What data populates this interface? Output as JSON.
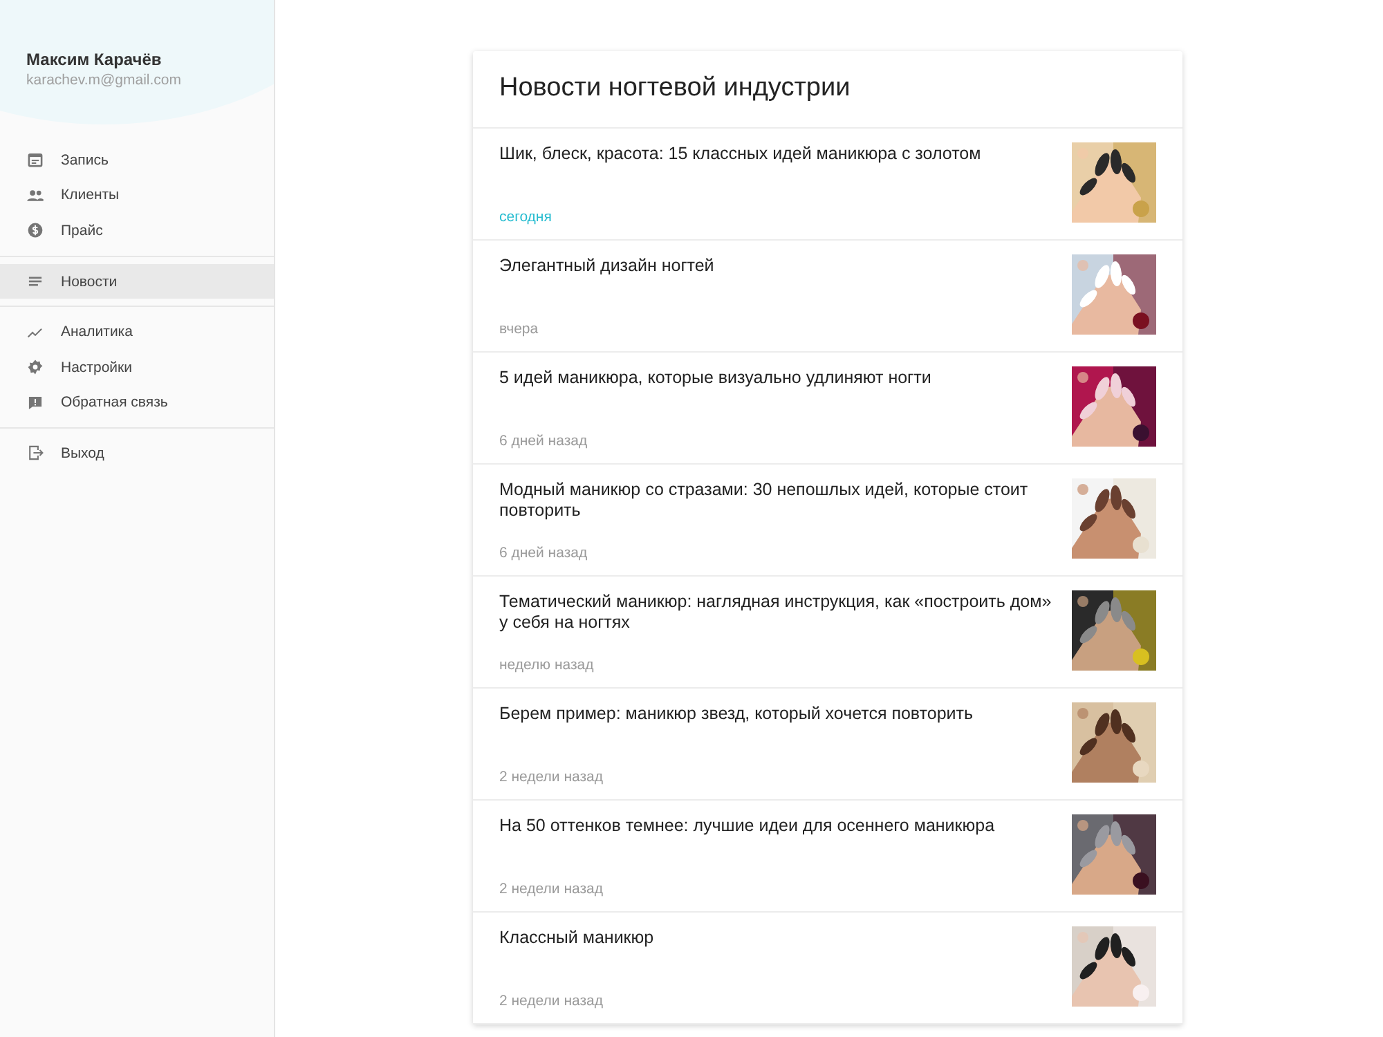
{
  "user": {
    "name": "Максим Карачёв",
    "email": "karachev.m@gmail.com"
  },
  "nav_groups": [
    [
      {
        "label": "Запись",
        "selected": false
      },
      {
        "label": "Клиенты",
        "selected": false
      },
      {
        "label": "Прайс",
        "selected": false
      }
    ],
    [
      {
        "label": "Новости",
        "selected": true
      }
    ],
    [
      {
        "label": "Аналитика",
        "selected": false
      },
      {
        "label": "Настройки",
        "selected": false
      },
      {
        "label": "Обратная связь",
        "selected": false
      }
    ],
    [
      {
        "label": "Выход",
        "selected": false
      }
    ]
  ],
  "news": {
    "title": "Новости ногтевой индустрии",
    "items": [
      {
        "title": "Шик, блеск, красота: 15 классных идей маникюра с золотом",
        "date": "сегодня",
        "fresh": true
      },
      {
        "title": "Элегантный дизайн ногтей",
        "date": "вчера",
        "fresh": false
      },
      {
        "title": "5 идей маникюра, которые визуально удлиняют ногти",
        "date": "6 дней назад",
        "fresh": false
      },
      {
        "title": "Модный маникюр со стразами: 30 непошлых идей, которые стоит повторить",
        "date": "6 дней назад",
        "fresh": false
      },
      {
        "title": "Тематический маникюр: наглядная инструкция, как «построить дом» у себя на ногтях",
        "date": "неделю назад",
        "fresh": false
      },
      {
        "title": "Берем пример: маникюр звезд, который хочется повторить",
        "date": "2 недели назад",
        "fresh": false
      },
      {
        "title": "На 50 оттенков темнее: лучшие идеи для осеннего маникюра",
        "date": "2 недели назад",
        "fresh": false
      },
      {
        "title": "Классный маникюр",
        "date": "2 недели назад",
        "fresh": false
      }
    ]
  }
}
